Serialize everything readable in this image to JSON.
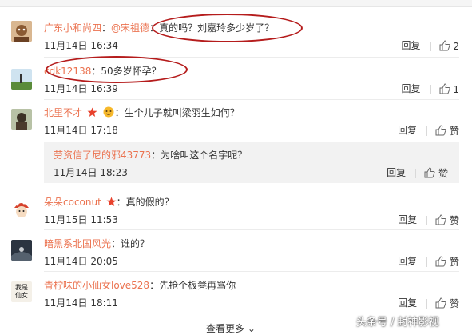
{
  "comments": [
    {
      "user": "广东小和尚四",
      "mention": "@宋祖德",
      "colon": "：",
      "text": "真的吗？刘嘉玲多少岁了？",
      "date": "11月14日 16:34",
      "reply": "回复",
      "like": "2"
    },
    {
      "user": "cdk12138",
      "colon": "：",
      "text": "50多岁怀孕？",
      "date": "11月14日 16:39",
      "reply": "回复",
      "like": "1"
    },
    {
      "user": "北里不才",
      "colon": "：",
      "text": "生个儿子就叫梁羽生如何？",
      "date": "11月14日 17:18",
      "reply": "回复",
      "like": "赞"
    },
    {
      "user": "朵朵coconut",
      "colon": "：",
      "text": "真的假的？",
      "date": "11月15日 11:53",
      "reply": "回复",
      "like": "赞"
    },
    {
      "user": "暗黑系北国风光",
      "colon": "：",
      "text": "谁的？",
      "date": "11月14日 20:05",
      "reply": "回复",
      "like": "赞"
    },
    {
      "user": "青柠味的小仙女love528",
      "colon": "：",
      "text": "先抢个板凳再骂你",
      "date": "11月14日 18:11",
      "reply": "回复",
      "like": "赞"
    }
  ],
  "subcomment": {
    "user": "劳资信了尼的邪43773",
    "colon": "：",
    "text": "为啥叫这个名字呢？",
    "date": "11月14日 18:23",
    "reply": "回复",
    "like": "赞"
  },
  "avatar6_text": "我是仙女",
  "more_label": "查看更多",
  "watermark": "头条号 / 封神影视",
  "colors": {
    "username": "#eb7350",
    "annotation": "#b51c1c",
    "subbox": "#f2f2f2"
  }
}
